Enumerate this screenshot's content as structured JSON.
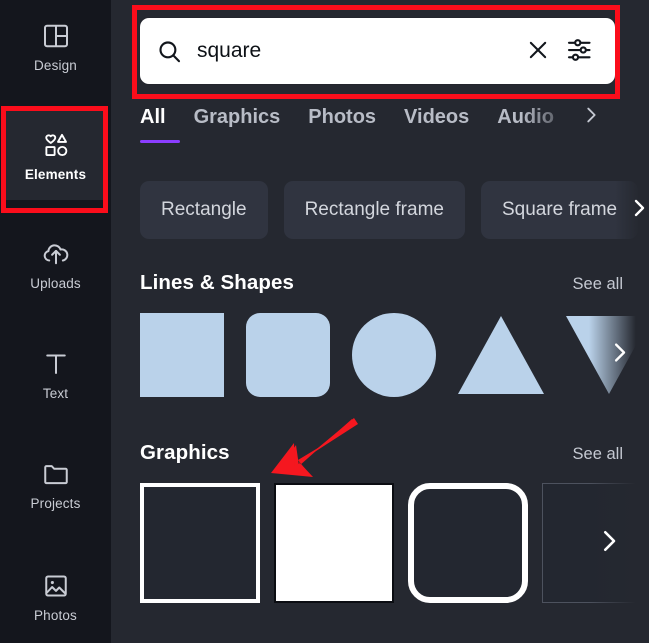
{
  "theme": {
    "rail_bg": "#14161d",
    "panel_bg": "#252830",
    "accent": "#8b3dff",
    "annotation": "#fb0d1b",
    "shape_fill": "#bad2ea",
    "chip_bg": "#303440"
  },
  "sidebar": {
    "items": [
      {
        "label": "Design",
        "icon": "design-icon",
        "active": false
      },
      {
        "label": "Elements",
        "icon": "elements-icon",
        "active": true
      },
      {
        "label": "Uploads",
        "icon": "uploads-icon",
        "active": false
      },
      {
        "label": "Text",
        "icon": "text-icon",
        "active": false
      },
      {
        "label": "Projects",
        "icon": "projects-icon",
        "active": false
      },
      {
        "label": "Photos",
        "icon": "photos-icon",
        "active": false
      }
    ]
  },
  "search": {
    "value": "square",
    "placeholder": "Search elements",
    "search_icon": "search-icon",
    "clear_icon": "close-icon",
    "filter_icon": "filter-sliders-icon"
  },
  "tabs": {
    "items": [
      {
        "label": "All",
        "active": true,
        "faded": false
      },
      {
        "label": "Graphics",
        "active": false,
        "faded": false
      },
      {
        "label": "Photos",
        "active": false,
        "faded": false
      },
      {
        "label": "Videos",
        "active": false,
        "faded": false
      },
      {
        "label": "Audio",
        "active": false,
        "faded": true
      }
    ],
    "next_icon": "chevron-right-icon"
  },
  "chips": {
    "items": [
      {
        "label": "Rectangle"
      },
      {
        "label": "Rectangle frame"
      },
      {
        "label": "Square frame"
      }
    ],
    "next_icon": "chevron-right-icon"
  },
  "sections": [
    {
      "title": "Lines & Shapes",
      "see_all": "See all",
      "next_icon": "chevron-right-icon",
      "items": [
        {
          "name": "square-shape",
          "kind": "square"
        },
        {
          "name": "rounded-square-shape",
          "kind": "rounded"
        },
        {
          "name": "circle-shape",
          "kind": "circle"
        },
        {
          "name": "triangle-shape",
          "kind": "triangle"
        },
        {
          "name": "triangle-down-shape",
          "kind": "triangle-down"
        }
      ]
    },
    {
      "title": "Graphics",
      "see_all": "See all",
      "next_icon": "chevron-right-icon",
      "items": [
        {
          "name": "square-outline-graphic",
          "kind": "outline-square"
        },
        {
          "name": "square-solid-white-graphic",
          "kind": "solid-white"
        },
        {
          "name": "rounded-square-outline-graphic",
          "kind": "outline-rounded"
        },
        {
          "name": "square-thin-outline-graphic",
          "kind": "outline-thin"
        }
      ]
    }
  ],
  "annotations": {
    "search_box": "red-highlight-box-search",
    "elements_box": "red-highlight-box-elements",
    "graphics_arrow": "red-arrow-pointing-to-first-graphic"
  }
}
